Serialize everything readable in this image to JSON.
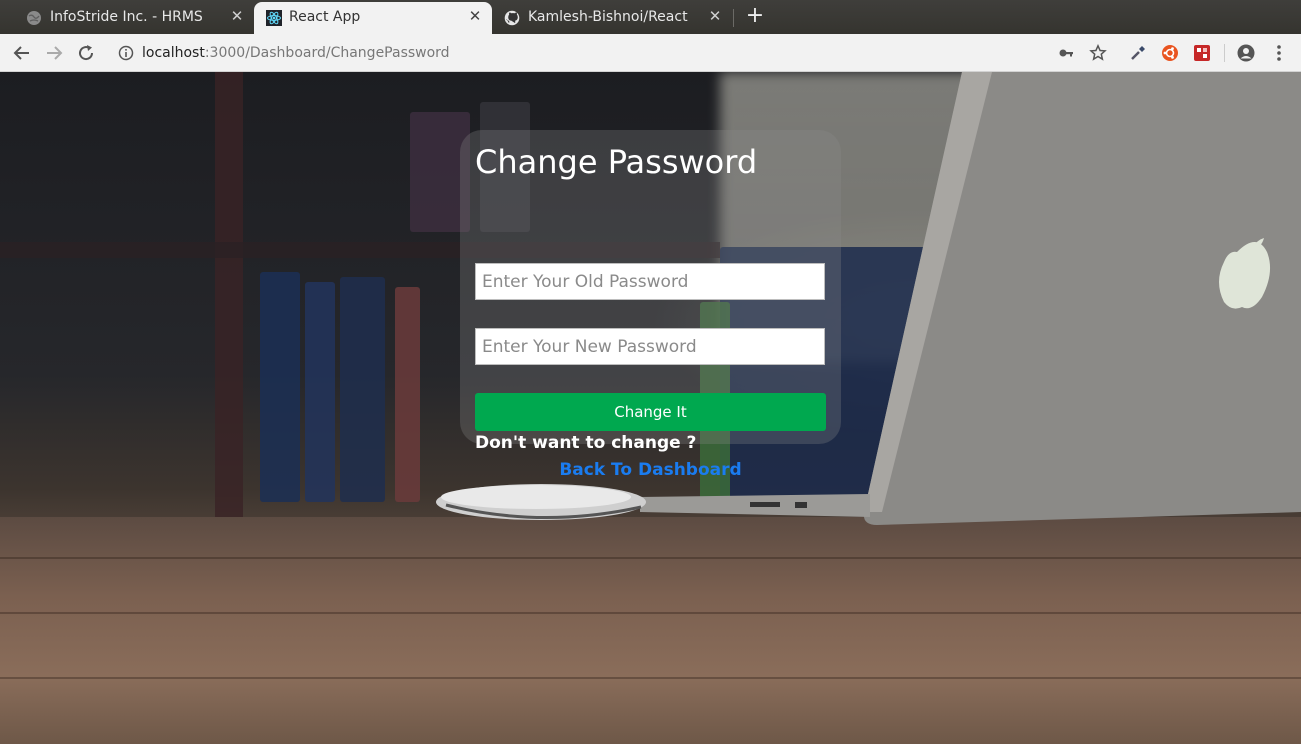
{
  "browser": {
    "tabs": [
      {
        "title": "InfoStride Inc. - HRMS",
        "icon": "globe-icon",
        "active": false
      },
      {
        "title": "React App",
        "icon": "react-icon",
        "active": true
      },
      {
        "title": "Kamlesh-Bishnoi/React-a",
        "icon": "github-icon",
        "active": false
      }
    ],
    "address": {
      "host": "localhost",
      "path": ":3000/Dashboard/ChangePassword"
    },
    "toolbar_icons": [
      "back-icon",
      "forward-icon",
      "reload-icon",
      "info-icon",
      "key-icon",
      "star-icon",
      "eyedropper-icon",
      "ubuntu-extension-icon",
      "extension-icon",
      "profile-icon",
      "menu-icon"
    ]
  },
  "form": {
    "title": "Change Password",
    "old_password_placeholder": "Enter Your Old Password",
    "new_password_placeholder": "Enter Your New Password",
    "submit_label": "Change It",
    "prompt": "Don't want to change ?",
    "back_link": "Back To Dashboard"
  },
  "colors": {
    "button_green": "#00a84f",
    "link_blue": "#1a7cf0"
  }
}
